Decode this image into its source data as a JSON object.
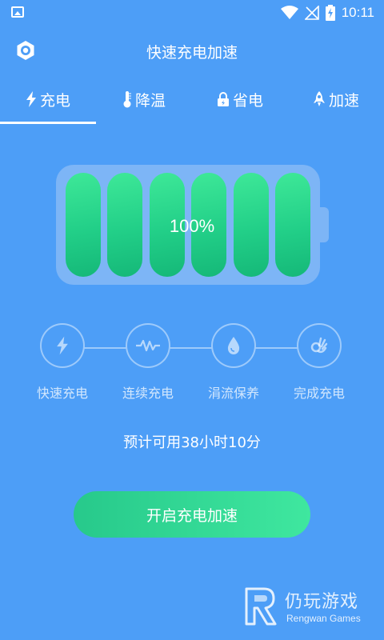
{
  "status_bar": {
    "time": "10:11"
  },
  "header": {
    "title": "快速充电加速"
  },
  "tabs": [
    {
      "label": "充电",
      "icon": "bolt-icon",
      "active": true
    },
    {
      "label": "降温",
      "icon": "thermometer-icon",
      "active": false
    },
    {
      "label": "省电",
      "icon": "lock-icon",
      "active": false
    },
    {
      "label": "加速",
      "icon": "rocket-icon",
      "active": false
    }
  ],
  "battery": {
    "level_label": "100%",
    "cells_filled": 6,
    "cells_total": 6,
    "cell_color": "#2fd98f"
  },
  "steps": [
    {
      "label": "快速充电",
      "icon": "bolt-icon"
    },
    {
      "label": "连续充电",
      "icon": "pulse-icon"
    },
    {
      "label": "涓流保养",
      "icon": "droplet-icon"
    },
    {
      "label": "完成充电",
      "icon": "ok-hand-icon"
    }
  ],
  "estimate": {
    "text": "预计可用38小时10分"
  },
  "action": {
    "label": "开启充电加速"
  },
  "watermark": {
    "name": "仍玩游戏",
    "sub": "Rengwan Games"
  },
  "colors": {
    "background": "#4d9ef7",
    "accent": "#2fd98f"
  }
}
